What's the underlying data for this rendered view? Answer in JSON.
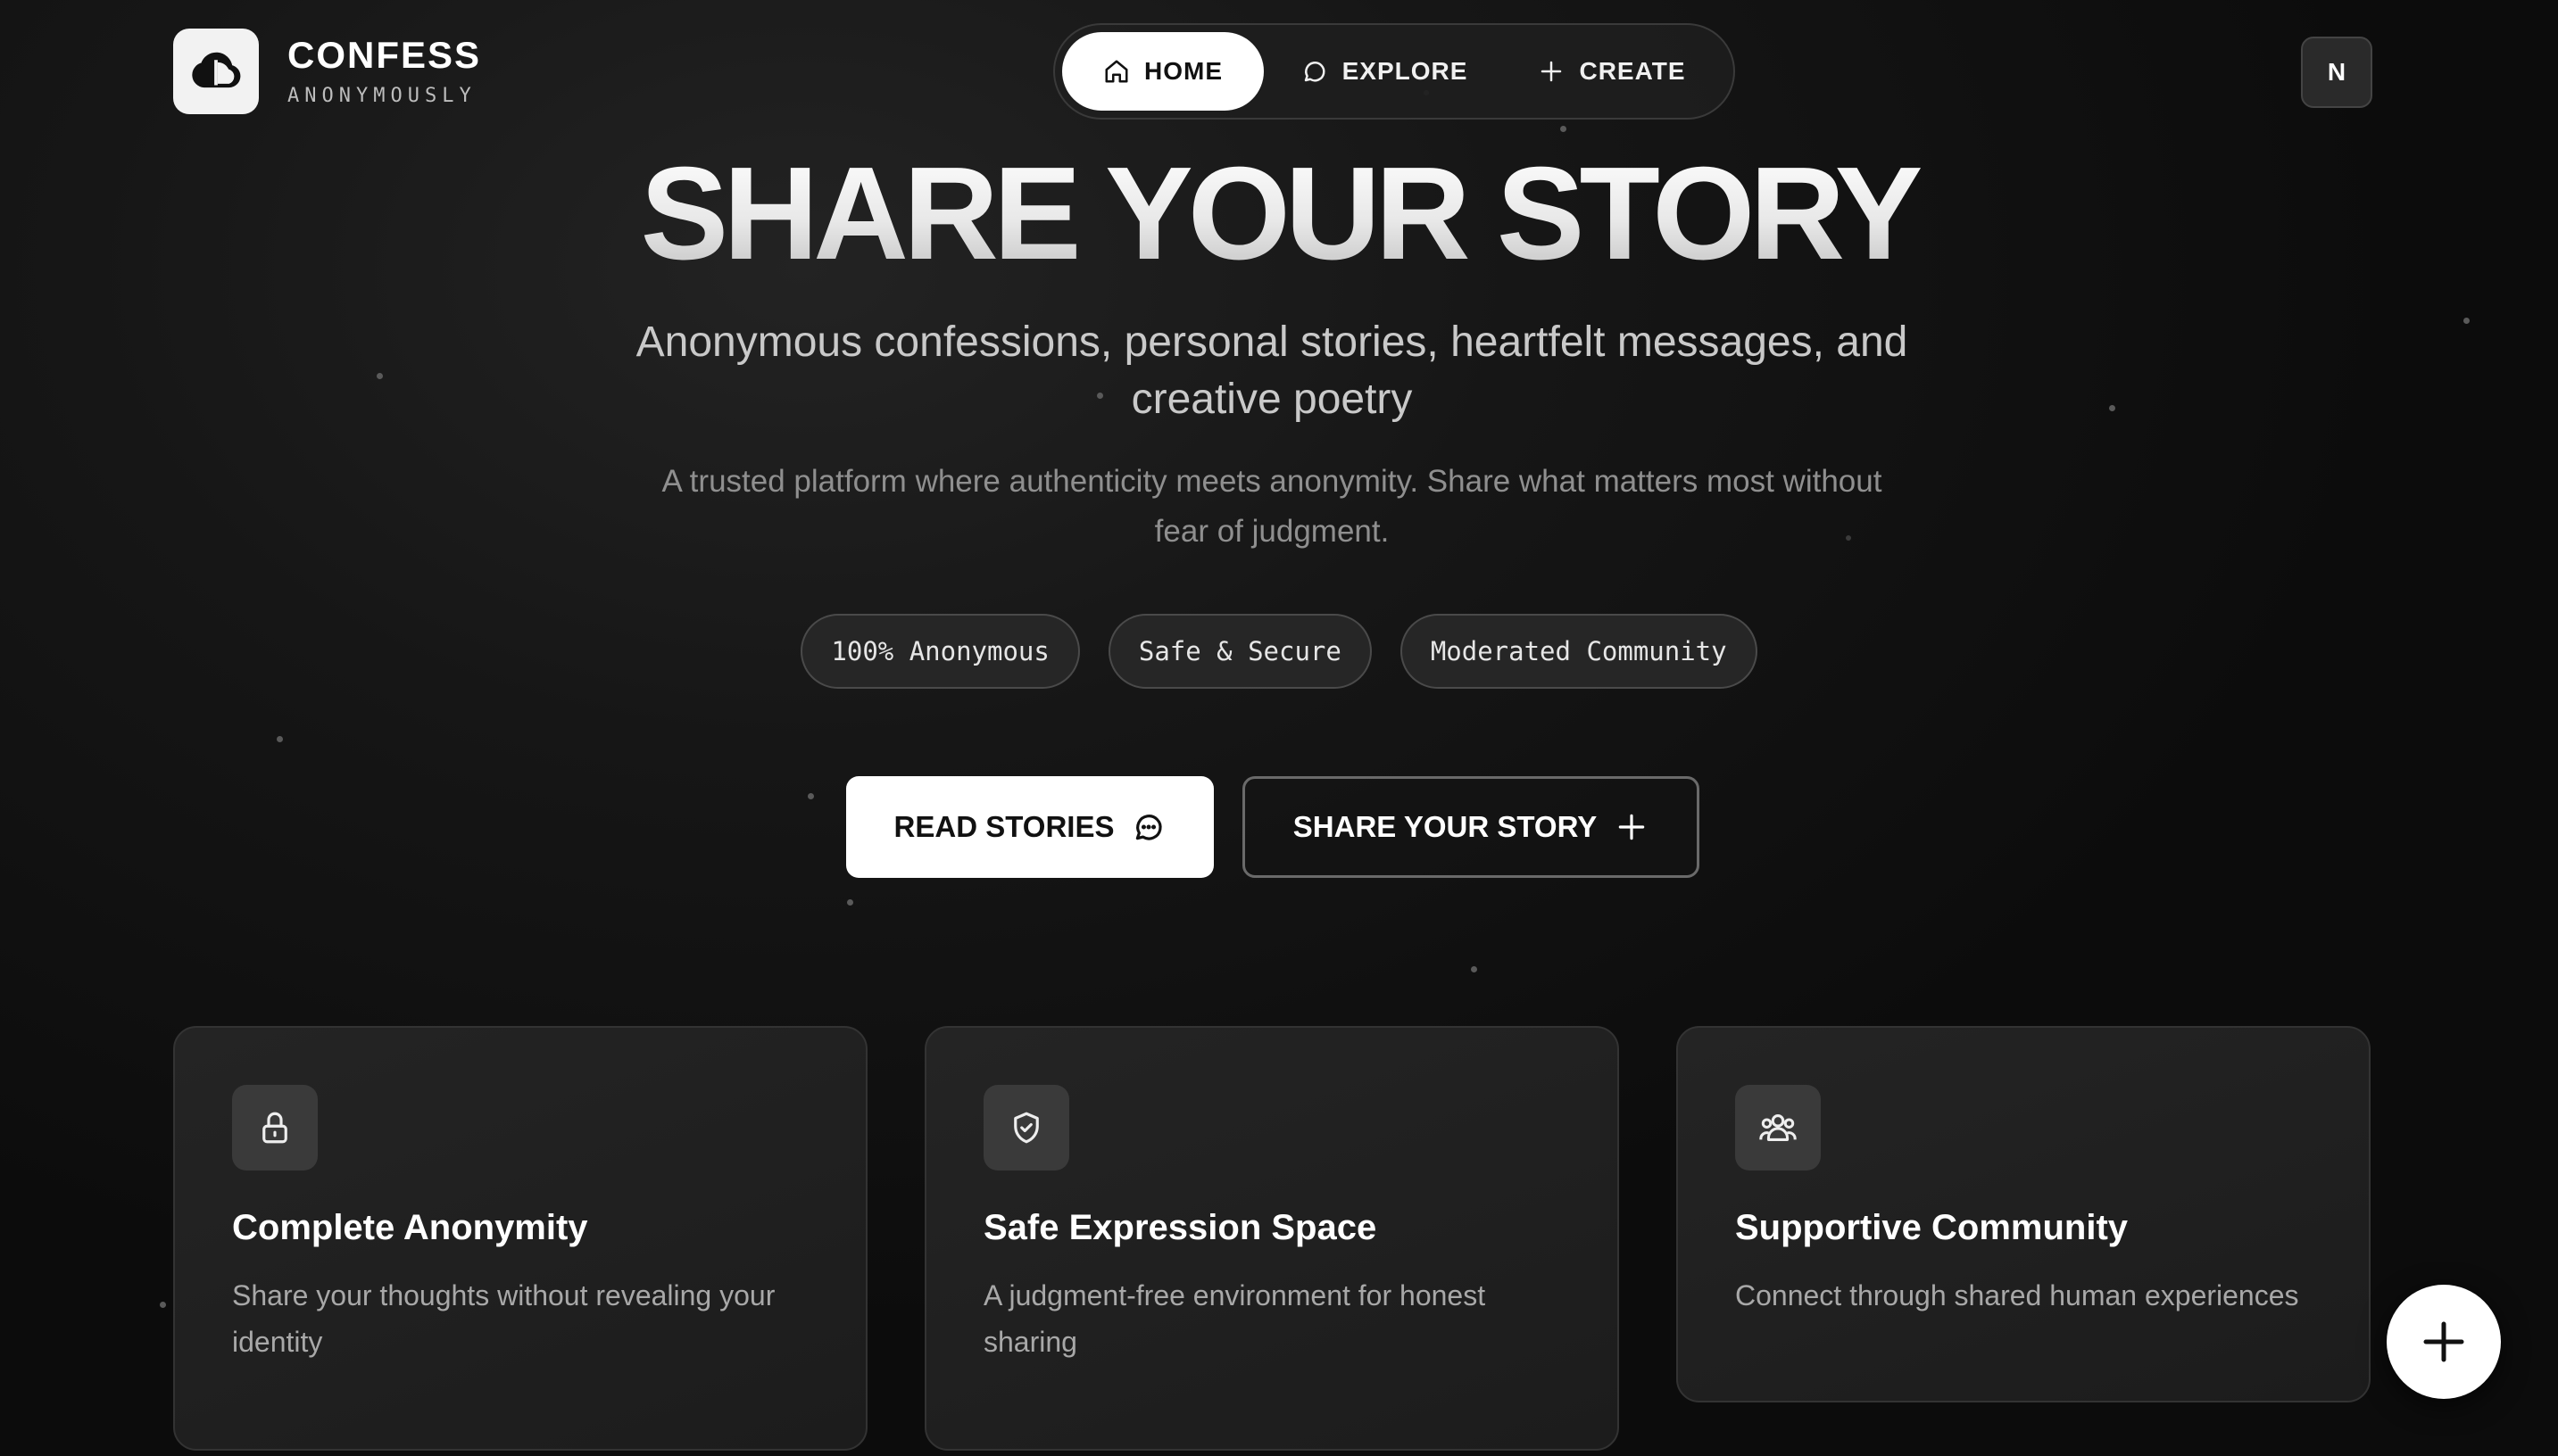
{
  "brand": {
    "title": "CONFESS",
    "subtitle": "ANONYMOUSLY",
    "logo_icon": "cloud-icon"
  },
  "nav": {
    "items": [
      {
        "label": "HOME",
        "icon": "home-icon",
        "active": true
      },
      {
        "label": "EXPLORE",
        "icon": "chat-icon",
        "active": false
      },
      {
        "label": "CREATE",
        "icon": "plus-icon",
        "active": false
      }
    ]
  },
  "user": {
    "initial": "N"
  },
  "hero": {
    "title": "SHARE YOUR STORY",
    "subtitle": "Anonymous confessions, personal stories, heartfelt messages, and creative poetry",
    "description": "A trusted platform where authenticity meets anonymity. Share what matters most without fear of judgment."
  },
  "badges": [
    "100% Anonymous",
    "Safe & Secure",
    "Moderated Community"
  ],
  "cta": {
    "primary_label": "READ STORIES",
    "secondary_label": "SHARE YOUR STORY"
  },
  "features": [
    {
      "icon": "lock-icon",
      "title": "Complete Anonymity",
      "text": "Share your thoughts without revealing your identity"
    },
    {
      "icon": "shield-check-icon",
      "title": "Safe Expression Space",
      "text": "A judgment-free environment for honest sharing"
    },
    {
      "icon": "users-icon",
      "title": "Supportive Community",
      "text": "Connect through shared human experiences"
    }
  ],
  "colors": {
    "background": "#0b0b0b",
    "accent": "#ffffff",
    "card": "#1f1f1f"
  }
}
